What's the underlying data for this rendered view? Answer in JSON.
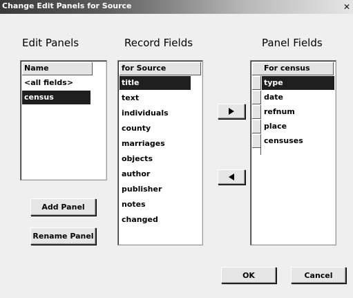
{
  "window": {
    "title": "Change Edit Panels for Source",
    "close_glyph": "✕"
  },
  "edit_panels": {
    "heading": "Edit Panels",
    "column_header": "Name",
    "items": [
      {
        "label": "<all fields>",
        "selected": false
      },
      {
        "label": "census",
        "selected": true
      }
    ],
    "add_button": "Add Panel",
    "rename_button": "Rename Panel"
  },
  "record_fields": {
    "heading": "Record Fields",
    "column_header": "for Source",
    "items": [
      {
        "label": "title",
        "selected": true
      },
      {
        "label": "text",
        "selected": false
      },
      {
        "label": "individuals",
        "selected": false
      },
      {
        "label": "county",
        "selected": false
      },
      {
        "label": "marriages",
        "selected": false
      },
      {
        "label": "objects",
        "selected": false
      },
      {
        "label": "author",
        "selected": false
      },
      {
        "label": "publisher",
        "selected": false
      },
      {
        "label": "notes",
        "selected": false
      },
      {
        "label": "changed",
        "selected": false
      }
    ]
  },
  "transfer": {
    "add_icon": "triangle-right-icon",
    "remove_icon": "triangle-left-icon"
  },
  "panel_fields": {
    "heading": "Panel Fields",
    "column_header": "For census",
    "items": [
      {
        "label": "type",
        "selected": true
      },
      {
        "label": "date",
        "selected": false
      },
      {
        "label": "refnum",
        "selected": false
      },
      {
        "label": "place",
        "selected": false
      },
      {
        "label": "censuses",
        "selected": false
      }
    ]
  },
  "footer": {
    "ok_label": "OK",
    "cancel_label": "Cancel"
  },
  "colors": {
    "selection": "#1f1f1f",
    "dialog_bg": "#efefef"
  }
}
